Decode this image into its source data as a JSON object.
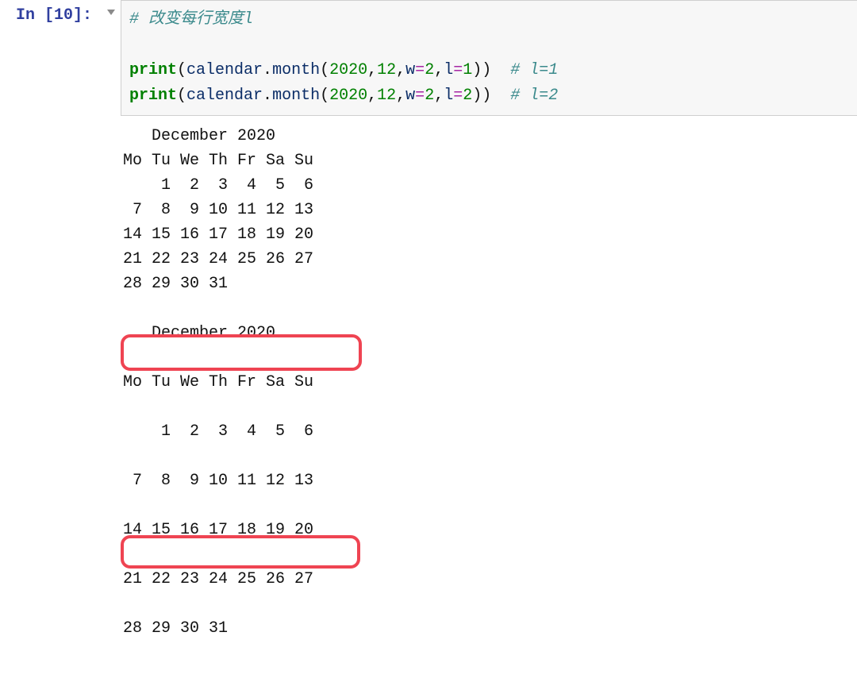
{
  "prompt": "In [10]:",
  "code": {
    "comment": "# 改变每行宽度l",
    "line1": "print(calendar.month(2020,12,w=2,l=1))",
    "line1_comment": "# l=1",
    "line2": "print(calendar.month(2020,12,w=2,l=2))",
    "line2_comment": "# l=2",
    "print_fn": "print",
    "module": "calendar",
    "method": "month",
    "year": "2020",
    "month": "12",
    "w_param": "w",
    "l_param": "l",
    "w_val": "2",
    "l_val1": "1",
    "l_val2": "2",
    "eq": "="
  },
  "output": {
    "cal1_title": "   December 2020",
    "cal_header": "Mo Tu We Th Fr Sa Su",
    "cal_rows": [
      "    1  2  3  4  5  6",
      " 7  8  9 10 11 12 13",
      "14 15 16 17 18 19 20",
      "21 22 23 24 25 26 27",
      "28 29 30 31"
    ],
    "cal2_title": "   December 2020",
    "cal2_header": "Mo Tu We Th Fr Sa Su",
    "cal2_rows": [
      "    1  2  3  4  5  6",
      " 7  8  9 10 11 12 13",
      "14 15 16 17 18 19 20",
      "21 22 23 24 25 26 27",
      "28 29 30 31"
    ]
  },
  "chart_data": {
    "type": "table",
    "title": "calendar.month output comparison with l=1 and l=2",
    "series": [
      {
        "name": "December 2020 (l=1)",
        "columns": [
          "Mo",
          "Tu",
          "We",
          "Th",
          "Fr",
          "Sa",
          "Su"
        ],
        "rows": [
          [
            "",
            "1",
            "2",
            "3",
            "4",
            "5",
            "6"
          ],
          [
            "7",
            "8",
            "9",
            "10",
            "11",
            "12",
            "13"
          ],
          [
            "14",
            "15",
            "16",
            "17",
            "18",
            "19",
            "20"
          ],
          [
            "21",
            "22",
            "23",
            "24",
            "25",
            "26",
            "27"
          ],
          [
            "28",
            "29",
            "30",
            "31",
            "",
            "",
            ""
          ]
        ]
      },
      {
        "name": "December 2020 (l=2)",
        "columns": [
          "Mo",
          "Tu",
          "We",
          "Th",
          "Fr",
          "Sa",
          "Su"
        ],
        "rows": [
          [
            "",
            "1",
            "2",
            "3",
            "4",
            "5",
            "6"
          ],
          [
            "7",
            "8",
            "9",
            "10",
            "11",
            "12",
            "13"
          ],
          [
            "14",
            "15",
            "16",
            "17",
            "18",
            "19",
            "20"
          ],
          [
            "21",
            "22",
            "23",
            "24",
            "25",
            "26",
            "27"
          ],
          [
            "28",
            "29",
            "30",
            "31",
            "",
            "",
            ""
          ]
        ]
      }
    ]
  }
}
